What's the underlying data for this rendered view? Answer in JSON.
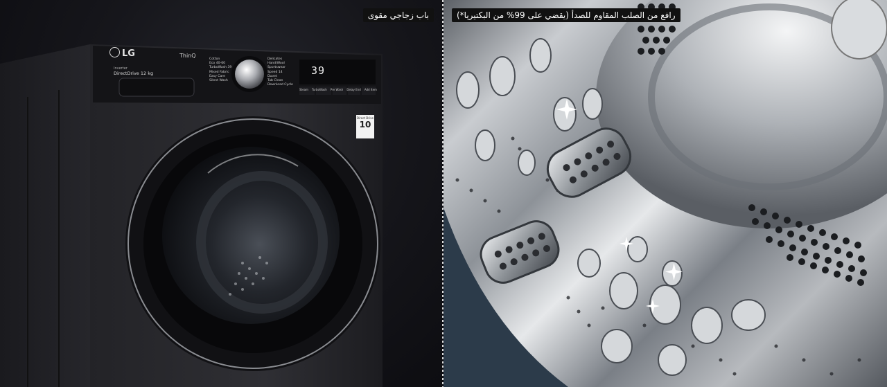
{
  "captions": {
    "left": "باب زجاجي مقوى",
    "right": "رافع من الصلب المقاوم للصدأ (يقضي على 99% من البكتيريا*)"
  },
  "washer": {
    "brand": "LG",
    "connectivity": "ThinQ",
    "tagline": "Inverter",
    "model": "DirectDrive 12 kg",
    "display": "39",
    "badge_line1": "Direct Drive",
    "badge_line2": "10",
    "programs_left": [
      "Cotton",
      "Eco 40-60",
      "TurboWash 39",
      "Mixed Fabric",
      "Easy Care",
      "Silent Wash"
    ],
    "programs_right": [
      "Delicates",
      "Hand/Wool",
      "Sportswear",
      "Speed 14",
      "Duvet",
      "Tub Clean",
      "Download Cycle"
    ],
    "buttons": [
      "Steam",
      "TurboWash",
      "Pre Wash",
      "Delay End",
      "Add Item"
    ]
  },
  "colors": {
    "caption_bg": "#111111",
    "washer_body": "#2a2a2e",
    "steel": "#c9ccd0"
  }
}
